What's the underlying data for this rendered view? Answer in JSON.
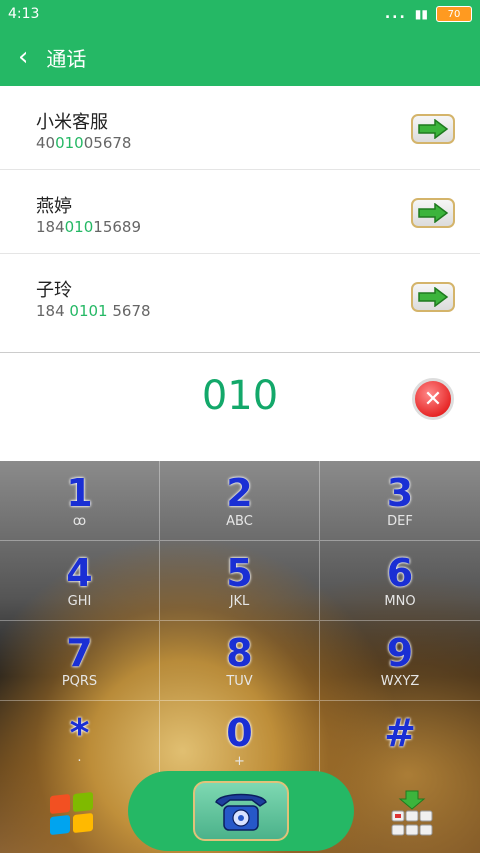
{
  "status_bar": {
    "time": "4:13",
    "dots": "...",
    "battery": "70"
  },
  "header": {
    "back_icon": "chevron-left-icon",
    "title": "通话"
  },
  "contacts": [
    {
      "name": "小米客服",
      "number_prefix": "40",
      "number_match": "010",
      "number_suffix": "05678"
    },
    {
      "name": "燕婷",
      "number_prefix": "184",
      "number_match": "010",
      "number_suffix": "15689"
    },
    {
      "name": "子玲",
      "number_prefix": "184 ",
      "number_match": "0101",
      "number_suffix": " 5678"
    }
  ],
  "input": {
    "typed_number": "010"
  },
  "keypad": {
    "keys": [
      {
        "num": "1",
        "sub": "ꝏ"
      },
      {
        "num": "2",
        "sub": "ABC"
      },
      {
        "num": "3",
        "sub": "DEF"
      },
      {
        "num": "4",
        "sub": "GHI"
      },
      {
        "num": "5",
        "sub": "JKL"
      },
      {
        "num": "6",
        "sub": "MNO"
      },
      {
        "num": "7",
        "sub": "PQRS"
      },
      {
        "num": "8",
        "sub": "TUV"
      },
      {
        "num": "9",
        "sub": "WXYZ"
      },
      {
        "num": "*",
        "sub": "·"
      },
      {
        "num": "0",
        "sub": "+"
      },
      {
        "num": "#",
        "sub": ""
      }
    ]
  },
  "colors": {
    "accent": "#25b865",
    "digit": "#1a2fd4",
    "match": "#25b865"
  }
}
